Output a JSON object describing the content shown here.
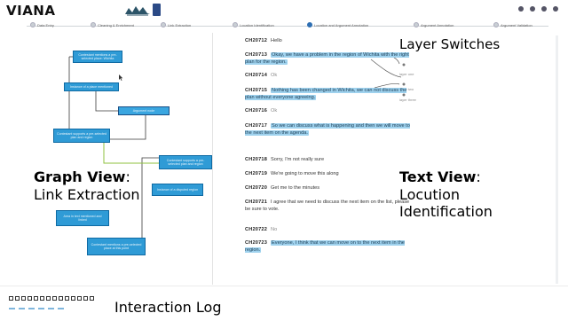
{
  "app": {
    "title": "VIANA"
  },
  "colors": {
    "node": "#2f9bd6",
    "node_border": "#0f6aa3",
    "highlight": "#9fd2ee",
    "edge": "#8fc23f",
    "active_step": "#2f6fb3"
  },
  "top_icons": [
    "user-icon",
    "settings-icon",
    "help-icon",
    "menu-icon"
  ],
  "steps": [
    {
      "label": "Data Entry"
    },
    {
      "label": "Cleaning & Enrichment"
    },
    {
      "label": "Link Extraction"
    },
    {
      "label": "Location Identification"
    },
    {
      "label": "Location and Argument Annotation",
      "active": true
    },
    {
      "label": "Argument Annotation"
    },
    {
      "label": "Argument Validation"
    }
  ],
  "graph": {
    "nodes": [
      {
        "label": "Contestant mentions a pre-selected place: Wichita"
      },
      {
        "label": "Instance of a place mentioned"
      },
      {
        "label": "Argument node"
      },
      {
        "label": "Contestant supports a pre-selected plan and region"
      },
      {
        "label": "Contestant supports a pre-selected plan and region"
      },
      {
        "label": "Instance of a disputed region"
      },
      {
        "label": "Area in text mentioned and linked"
      },
      {
        "label": "Contestant mentions a pre-selected place at this point"
      }
    ]
  },
  "annotations": {
    "graph_view_bold": "Graph View",
    "graph_view_colon": ":",
    "link_extraction": "Link Extraction",
    "layer_switches": "Layer Switches",
    "text_view_bold": "Text View",
    "text_view_colon": ":",
    "locution_line1": "Locution",
    "locution_line2": "Identification",
    "interaction_log": "Interaction Log"
  },
  "layer_notes": [
    "layer one",
    "layer two",
    "layer three"
  ],
  "text_view": {
    "paragraphs": [
      {
        "num": "CH20712",
        "text": "Hello"
      },
      {
        "num": "CH20713",
        "text": "Okay, we have a problem in the region of Wichita with the right plan for the region."
      },
      {
        "num": "CH20714",
        "text": "Ok"
      },
      {
        "num": "CH20715",
        "text": "Nothing has been changed in Wichita, we can not discuss the plan without everyone agreeing."
      },
      {
        "num": "CH20716",
        "text": "Ok"
      },
      {
        "num": "CH20717",
        "text": "So we can discuss what is happening and then we will move to the next item on the agenda."
      },
      {
        "num": "CH20718",
        "text": "Sorry, I'm not really sure"
      },
      {
        "num": "CH20719",
        "text": "We're going to move this along"
      },
      {
        "num": "CH20720",
        "text": "Get me to the minutes"
      },
      {
        "num": "CH20721",
        "text": "I agree that we need to discuss the next item on the list, please be sure to vote."
      },
      {
        "num": "CH20722",
        "text": "No"
      },
      {
        "num": "CH20723",
        "text": "Everyone, I think that we can move on to the next item in the region."
      }
    ]
  }
}
